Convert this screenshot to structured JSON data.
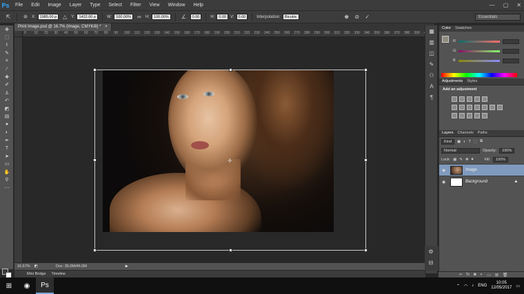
{
  "app": {
    "logo": "Ps",
    "menus": [
      "File",
      "Edit",
      "Image",
      "Layer",
      "Type",
      "Select",
      "Filter",
      "View",
      "Window",
      "Help"
    ],
    "window_controls": [
      "—",
      "▢",
      "✕"
    ]
  },
  "options_bar": {
    "x_label": "X:",
    "x_value": "1985.00 p",
    "y_label": "Y:",
    "y_value": "1422.00 p",
    "w_label": "W:",
    "w_value": "100.00%",
    "h_label": "H:",
    "h_value": "100.00%",
    "angle_value": "0.00",
    "hskew_label": "H:",
    "hskew_value": "0.00",
    "vskew_label": "V:",
    "vskew_value": "0.00",
    "interpolation_label": "Interpolation:",
    "interpolation_value": "Bicubic",
    "workspace": "Essentials"
  },
  "document": {
    "tab_title": "Print Image.psd @ 16.7% (Image, CMYK/8) *",
    "close": "×"
  },
  "rulers": {
    "top": [
      "0",
      "10",
      "20",
      "30",
      "40",
      "50",
      "60",
      "70",
      "80",
      "90",
      "100",
      "110",
      "120",
      "130",
      "140",
      "150",
      "160",
      "170",
      "180",
      "190",
      "200",
      "210",
      "220",
      "230",
      "240",
      "250",
      "260",
      "270",
      "280",
      "290",
      "300",
      "310",
      "320",
      "330",
      "340",
      "350",
      "360",
      "370",
      "380",
      "390",
      "400"
    ]
  },
  "status": {
    "zoom": "16.67%",
    "doc": "Doc: 35.0M/46.0M"
  },
  "bottom_tabs": [
    "Mini Bridge",
    "Timeline"
  ],
  "color_panel": {
    "tabs": [
      "Color",
      "Swatches"
    ],
    "channels": [
      "R",
      "G",
      "B"
    ]
  },
  "adjustments_panel": {
    "tabs": [
      "Adjustments",
      "Styles"
    ],
    "title": "Add an adjustment"
  },
  "layers_panel": {
    "tabs": [
      "Layers",
      "Channels",
      "Paths"
    ],
    "kind": "Kind",
    "blend_mode": "Normal",
    "opacity_label": "Opacity:",
    "opacity_value": "100%",
    "lock_label": "Lock:",
    "fill_label": "Fill:",
    "fill_value": "100%",
    "layers": [
      {
        "name": "Image",
        "selected": true
      },
      {
        "name": "Background",
        "selected": false
      }
    ]
  },
  "taskbar": {
    "time": "10:05",
    "date": "12/05/2017",
    "lang": "ENG"
  }
}
